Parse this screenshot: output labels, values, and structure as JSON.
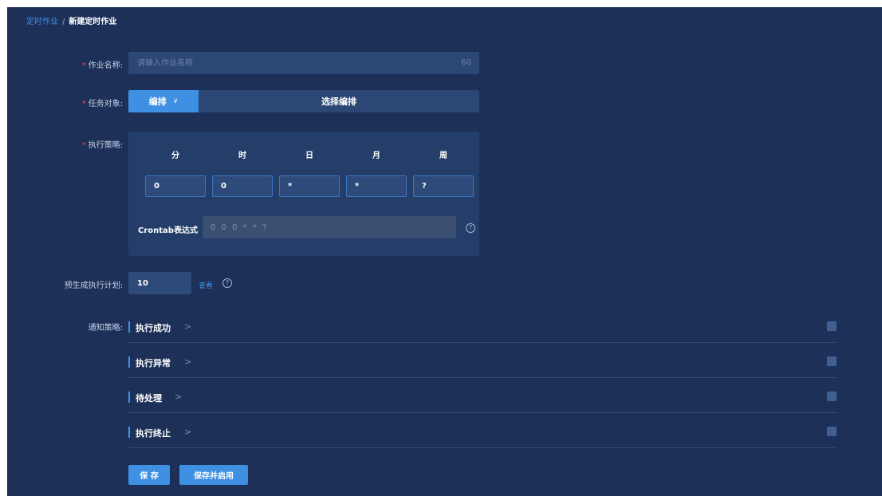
{
  "breadcrumb": {
    "parent": "定时作业",
    "separator": "/",
    "current": "新建定时作业"
  },
  "form": {
    "name": {
      "label": "作业名称:",
      "placeholder": "请输入作业名称",
      "counter": "60"
    },
    "task": {
      "label": "任务对象:",
      "type_label": "编排",
      "type_chevron": "∨",
      "select_label": "选择编排"
    },
    "strategy": {
      "label": "执行策略:",
      "headers": [
        "分",
        "时",
        "日",
        "月",
        "周"
      ],
      "values": [
        "0",
        "0",
        "*",
        "*",
        "?"
      ],
      "crontab_label": "Crontab表达式",
      "crontab_value": "0 0 0 * * ?"
    },
    "plan": {
      "label": "预生成执行计划:",
      "value": "10",
      "view_label": "查看"
    },
    "notify": {
      "label": "通知策略:",
      "items": [
        {
          "title": "执行成功",
          "chevron": ">"
        },
        {
          "title": "执行异常",
          "chevron": ">"
        },
        {
          "title": "待处理",
          "chevron": ">"
        },
        {
          "title": "执行终止",
          "chevron": ">"
        }
      ]
    }
  },
  "actions": {
    "save_label": "保 存",
    "save_enable_label": "保存并启用"
  },
  "colors": {
    "background": "#1c3058",
    "accent": "#3f90e3",
    "required": "#e84a4a"
  },
  "icons": {
    "help": "help-circle-icon",
    "chevron": "chevron-right-icon"
  }
}
